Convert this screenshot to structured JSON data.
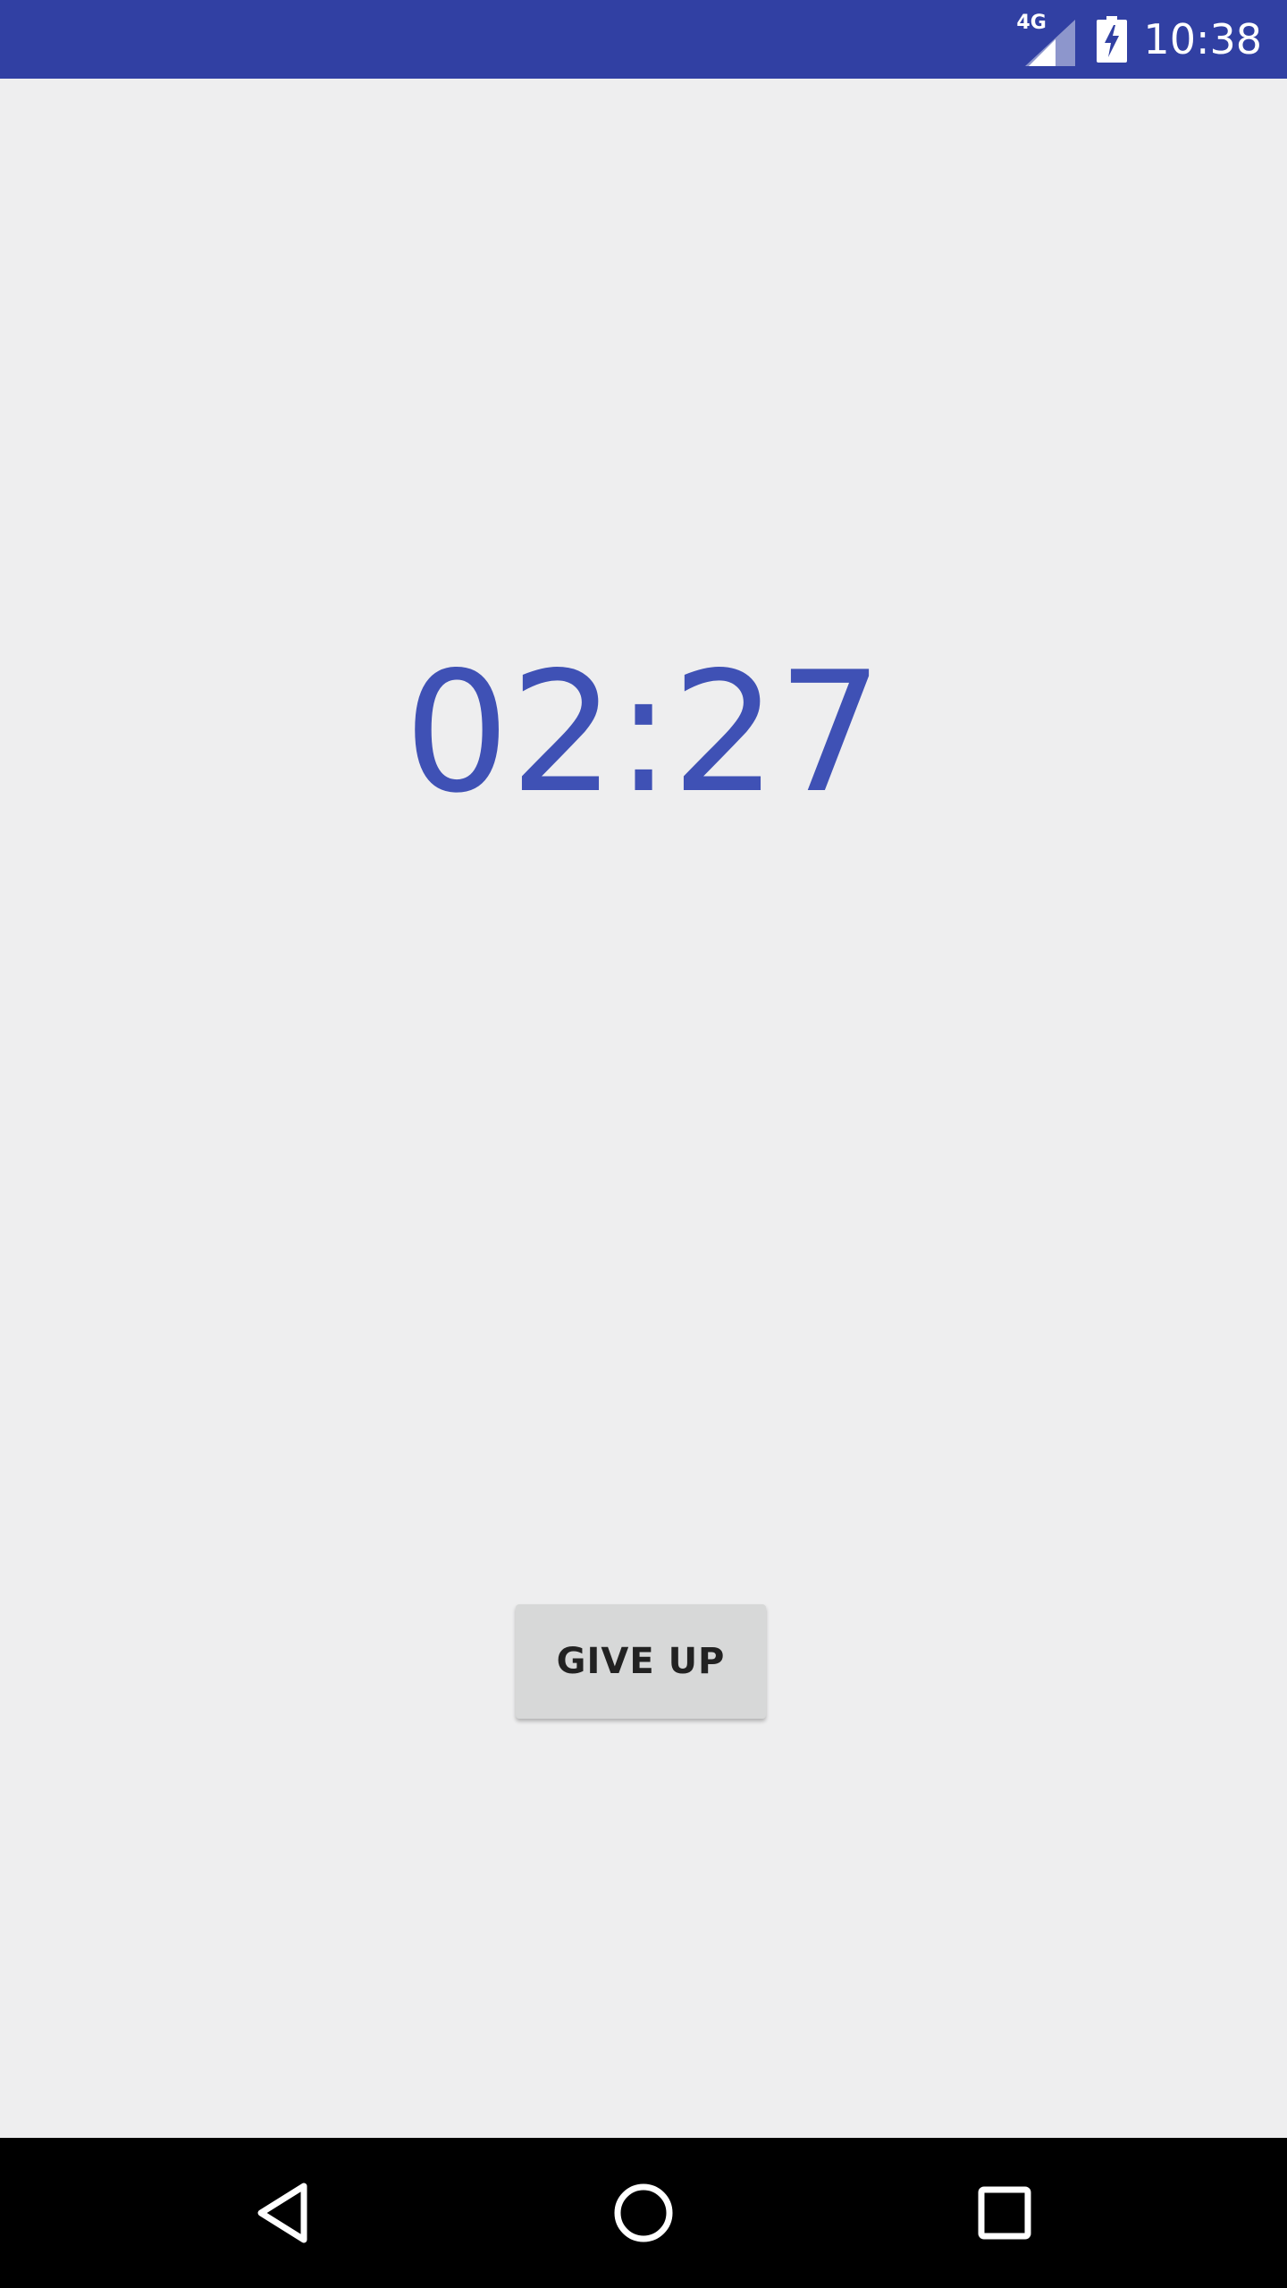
{
  "status_bar": {
    "network_type": "4G",
    "signal_icon": "cell-signal-icon",
    "battery_icon": "battery-charging-icon",
    "time": "10:38",
    "color": "#3140a3"
  },
  "main": {
    "timer_value": "02:27",
    "timer_color": "#3f51b5",
    "give_up_label": "GIVE UP"
  },
  "nav_bar": {
    "back_icon": "back-triangle-icon",
    "home_icon": "home-circle-icon",
    "recents_icon": "recents-square-icon"
  }
}
